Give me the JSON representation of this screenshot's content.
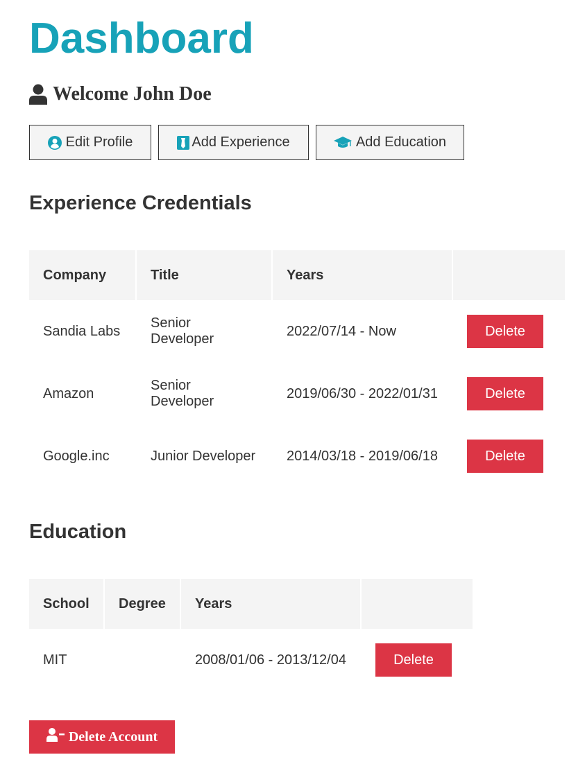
{
  "page": {
    "title": "Dashboard",
    "welcome": "Welcome John Doe"
  },
  "actions": {
    "edit_profile": "Edit Profile",
    "add_experience": "Add Experience",
    "add_education": "Add Education"
  },
  "experience": {
    "heading": "Experience Credentials",
    "columns": [
      "Company",
      "Title",
      "Years",
      ""
    ],
    "rows": [
      {
        "company": "Sandia Labs",
        "title": "Senior Developer",
        "years": "2022/07/14 - Now",
        "action": "Delete"
      },
      {
        "company": "Amazon",
        "title": "Senior Developer",
        "years": "2019/06/30 - 2022/01/31",
        "action": "Delete"
      },
      {
        "company": "Google.inc",
        "title": "Junior Developer",
        "years": "2014/03/18 - 2019/06/18",
        "action": "Delete"
      }
    ]
  },
  "education": {
    "heading": "Education",
    "columns": [
      "School",
      "Degree",
      "Years",
      ""
    ],
    "rows": [
      {
        "school": "MIT",
        "degree": "",
        "years": "2008/01/06 - 2013/12/04",
        "action": "Delete"
      }
    ]
  },
  "danger": {
    "delete_account": "Delete Account"
  },
  "colors": {
    "brand": "#17a2b8",
    "danger": "#dc3545",
    "text": "#333333",
    "light": "#f4f4f4"
  },
  "icons": [
    "user-icon",
    "user-circle-icon",
    "id-badge-icon",
    "graduation-cap-icon",
    "user-minus-icon"
  ]
}
